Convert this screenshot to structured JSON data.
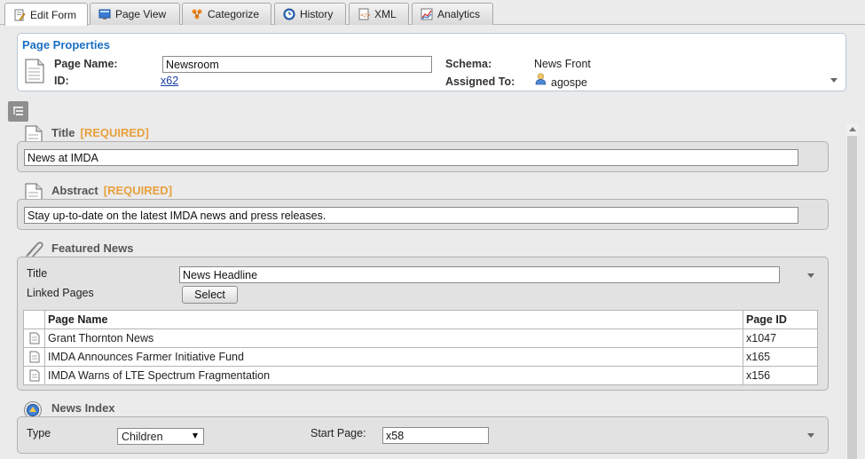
{
  "tabs": [
    {
      "label": "Edit Form",
      "icon": "edit-form-icon"
    },
    {
      "label": "Page View",
      "icon": "monitor-icon"
    },
    {
      "label": "Categorize",
      "icon": "categorize-icon"
    },
    {
      "label": "History",
      "icon": "history-icon"
    },
    {
      "label": "XML",
      "icon": "xml-icon"
    },
    {
      "label": "Analytics",
      "icon": "chart-icon"
    }
  ],
  "properties": {
    "title": "Page Properties",
    "page_name_label": "Page Name:",
    "page_name_value": "Newsroom",
    "id_label": "ID:",
    "id_value": "x62",
    "schema_label": "Schema:",
    "schema_value": "News Front",
    "assigned_label": "Assigned To:",
    "assigned_value": "agospe"
  },
  "title_section": {
    "label": "Title",
    "required": "[REQUIRED]",
    "value": "News at IMDA"
  },
  "abstract_section": {
    "label": "Abstract",
    "required": "[REQUIRED]",
    "value": "Stay up-to-date on the latest IMDA news and press releases."
  },
  "featured": {
    "label": "Featured News",
    "title_label": "Title",
    "title_value": "News Headline",
    "linked_label": "Linked Pages",
    "select_button": "Select",
    "columns": [
      "Page Name",
      "Page ID"
    ],
    "rows": [
      {
        "name": "Grant Thornton News",
        "id": "x1047"
      },
      {
        "name": "IMDA Announces Farmer Initiative Fund",
        "id": "x165"
      },
      {
        "name": "IMDA Warns of LTE Spectrum Fragmentation",
        "id": "x156"
      }
    ]
  },
  "news_index": {
    "label": "News Index",
    "type_label": "Type",
    "type_value": "Children",
    "start_label": "Start Page:",
    "start_value": "x58"
  },
  "colors": {
    "accent": "#1b6fc2",
    "required": "#e8a03c",
    "link": "#1a3ca8"
  }
}
